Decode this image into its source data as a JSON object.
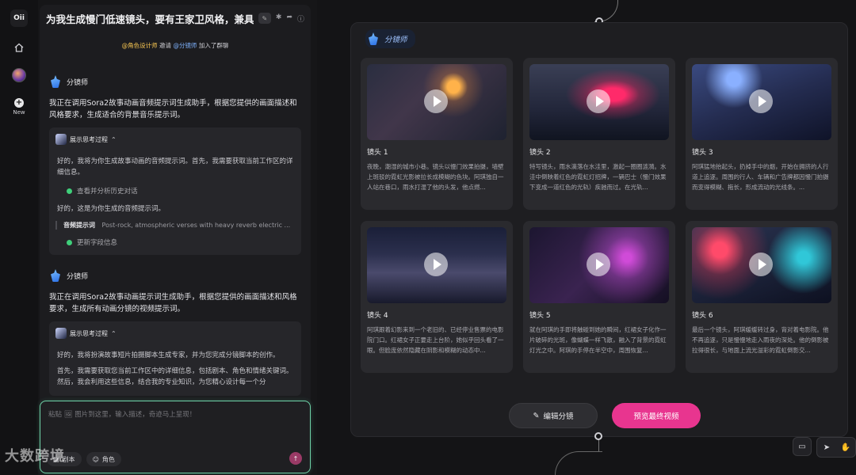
{
  "rail": {
    "logo": "Oii",
    "new_label": "New"
  },
  "chat": {
    "title": "为我生成慢门低速镜头，要有王家卫风格，兼具港风",
    "invite": {
      "inviter": "@角色设计师",
      "verb": "邀请",
      "invitee": "@分镜师",
      "suffix": "加入了群聊"
    },
    "messages": [
      {
        "name": "分镜师",
        "text": "我正在调用Sora2故事动画音频提示词生成助手，根据您提供的画面描述和风格要求，生成适合的背景音乐提示词。",
        "think_label": "展示思考过程",
        "think_text_1": "好的，我将为你生成故事动画的音频提示词。首先，我需要获取当前工作区的详细信息。",
        "step_1": "查看并分析历史对话",
        "think_text_2": "好的，这是为你生成的音频提示词。",
        "audio_label": "音频提示词",
        "audio_value": "Post-rock, atmospheric verses with heavy reverb electric ...",
        "step_2": "更新字段信息"
      },
      {
        "name": "分镜师",
        "text": "我正在调用Sora2故事动画提示词生成助手，根据您提供的画面描述和风格要求，生成所有动画分镜的视频提示词。",
        "think_label": "展示思考过程",
        "think_text_1": "好的，我将扮演故事短片拍摄脚本生成专家，并为您完成分镜脚本的创作。",
        "think_text_2": "首先，我需要获取您当前工作区中的详细信息，包括剧本、角色和情绪关键词。然后，我会利用这些信息，结合我的专业知识，为您精心设计每一个分"
      }
    ],
    "input": {
      "placeholder": "粘贴 🖼 图片到这里，输入描述，奇迹马上呈现！",
      "tool_1": "剧本",
      "tool_2": "角色"
    },
    "watermark": "大数跨境"
  },
  "board": {
    "title": "分镜师",
    "shots": [
      {
        "title": "镜头 1",
        "desc": "夜晚，潮湿的城市小巷。镜头以慢门效果拍摄，墙壁上斑驳的霓虹光影被拉长成模糊的色块。阿琪独自一人站在巷口，雨水打湿了他的头发，他点燃..."
      },
      {
        "title": "镜头 2",
        "desc": "特写镜头，雨水滴落在水洼里，激起一圈圈涟漪。水洼中倒映着红色的霓虹灯招牌，一辆巴士（慢门效果下变成一道红色的光轨）疾驰而过。在光轨..."
      },
      {
        "title": "镜头 3",
        "desc": "阿琪猛地抬起头，扔掉手中的烟，开始在拥挤的人行道上追逐。周围的行人、车辆和广告牌都因慢门拍摄而变得模糊、拖长，形成流动的光线条。..."
      },
      {
        "title": "镜头 4",
        "desc": "阿琪跟着幻影来到一个老旧的、已经停业售票的电影院门口。红裙女子正要走上台阶，她似乎回头看了一眼。但脸庞依然隐藏在阴影和模糊的动态中..."
      },
      {
        "title": "镜头 5",
        "desc": "就在阿琪的手即将触碰到她的瞬间，红裙女子化作一片破碎的光斑，像蝴蝶一样飞散，融入了背景的霓虹灯光之中。阿琪的手停在半空中，周围恢复..."
      },
      {
        "title": "镜头 6",
        "desc": "最后一个镜头，阿琪缓缓转过身，背对着电影院。他不再追逐，只是慢慢地走入雨夜的深处。他的倒影被拉得很长，与地面上流光溢彩的霓虹倒影交..."
      }
    ],
    "edit_label": "编辑分镜",
    "preview_label": "预览最终视频"
  },
  "colors": {
    "accent_pink": "#e8358f",
    "input_border": "#6fd3a8",
    "step_ok": "#3fcf7a"
  }
}
